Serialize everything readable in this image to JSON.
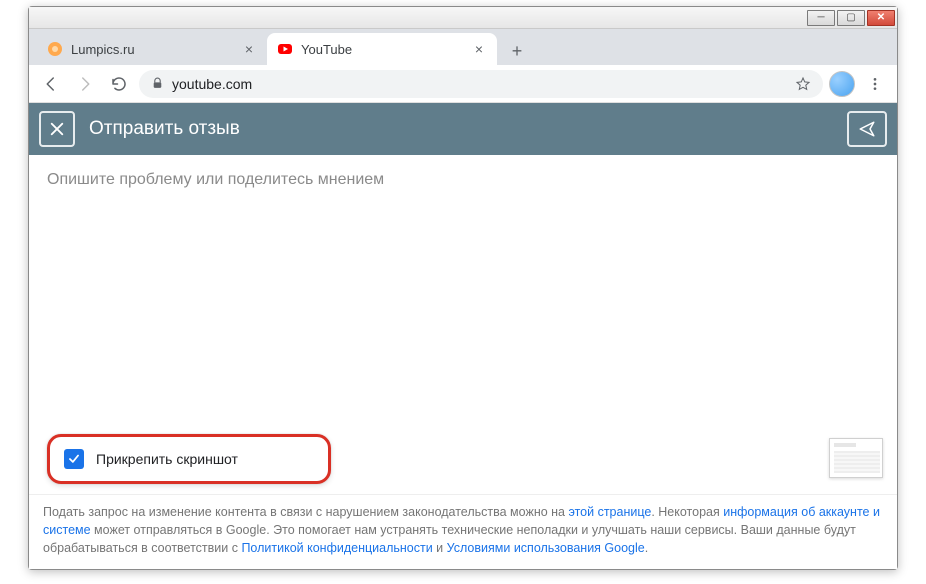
{
  "window_controls": {
    "min": "─",
    "max": "▢",
    "close": "✕"
  },
  "tabs": [
    {
      "title": "Lumpics.ru",
      "active": false
    },
    {
      "title": "YouTube",
      "active": true
    }
  ],
  "newtab": "+",
  "addressbar": {
    "url_display": "youtube.com"
  },
  "feedback": {
    "title": "Отправить отзыв",
    "placeholder": "Опишите проблему или поделитесь мнением",
    "attach_label": "Прикрепить скриншот",
    "attach_checked": true
  },
  "footer": {
    "t1": "Подать запрос на изменение контента в связи с нарушением законодательства можно на ",
    "link1": "этой странице",
    "t2": ". Некоторая ",
    "link2": "информация об аккаунте и системе",
    "t3": " может отправляться в Google. Это помогает нам устранять технические неполадки и улучшать наши сервисы. Ваши данные будут обрабатываться в соответствии с ",
    "link3": "Политикой конфиденциальности",
    "t4": " и ",
    "link4": "Условиями использования Google",
    "t5": "."
  }
}
